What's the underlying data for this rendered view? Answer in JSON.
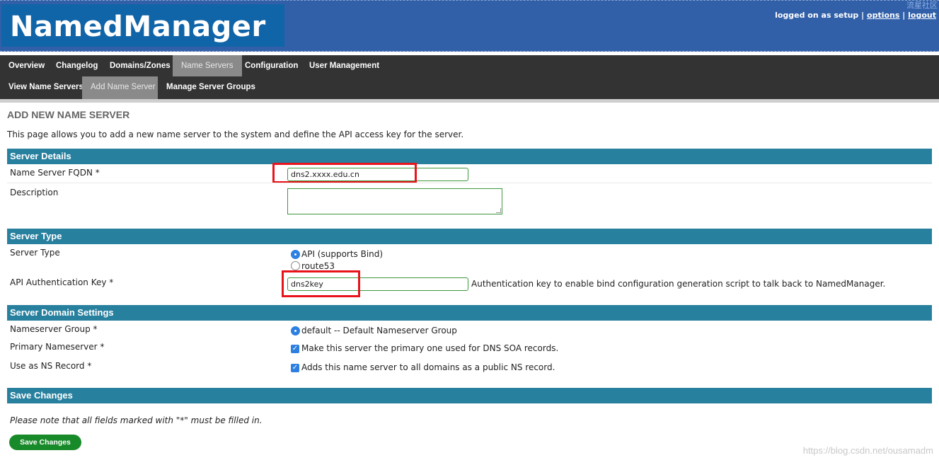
{
  "header": {
    "app_title": "NamedManager",
    "logged_on_text": "logged on as setup",
    "options_link": "options",
    "logout_link": "logout",
    "separator": "|",
    "watermark_top": "流星社区"
  },
  "nav": {
    "primary": [
      {
        "label": "Overview",
        "active": false
      },
      {
        "label": "Changelog",
        "active": false
      },
      {
        "label": "Domains/Zones",
        "active": false
      },
      {
        "label": "Name Servers",
        "active": true
      },
      {
        "label": "Configuration",
        "active": false
      },
      {
        "label": "User Management",
        "active": false
      }
    ],
    "secondary": [
      {
        "label": "View Name Servers",
        "active": false
      },
      {
        "label": "Add Name Server",
        "active": true
      },
      {
        "label": "Manage Server Groups",
        "active": false
      }
    ]
  },
  "page": {
    "title": "ADD NEW NAME SERVER",
    "intro": "This page allows you to add a new name server to the system and define the API access key for the server."
  },
  "sections": {
    "server_details": {
      "heading": "Server Details",
      "fqdn_label": "Name Server FQDN *",
      "fqdn_value": "dns2.xxxx.edu.cn",
      "description_label": "Description",
      "description_value": ""
    },
    "server_type": {
      "heading": "Server Type",
      "type_label": "Server Type",
      "option_api": "API (supports Bind)",
      "option_route53": "route53",
      "selected": "API (supports Bind)",
      "api_key_label": "API Authentication Key *",
      "api_key_value": "dns2key",
      "api_key_help": "Authentication key to enable bind configuration generation script to talk back to NamedManager."
    },
    "domain_settings": {
      "heading": "Server Domain Settings",
      "group_label": "Nameserver Group *",
      "group_option": "default -- Default Nameserver Group",
      "primary_label": "Primary Nameserver *",
      "primary_text": "Make this server the primary one used for DNS SOA records.",
      "primary_checked": true,
      "ns_record_label": "Use as NS Record *",
      "ns_record_text": "Adds this name server to all domains as a public NS record.",
      "ns_record_checked": true
    },
    "save": {
      "heading": "Save Changes",
      "note": "Please note that all fields marked with \"*\" must be filled in.",
      "button_label": "Save Changes"
    }
  },
  "watermark_bottom": "https://blog.csdn.net/ousamadm",
  "colors": {
    "header_bg": "#3160a9",
    "logo_bg": "#1064a8",
    "nav_bg": "#333333",
    "section_bar": "#28809f",
    "save_button": "#198a2a",
    "highlight_red": "#e8141b"
  },
  "icons": {
    "checkbox_checked": "check-mark-icon",
    "radio_selected": "radio-dot-icon"
  }
}
